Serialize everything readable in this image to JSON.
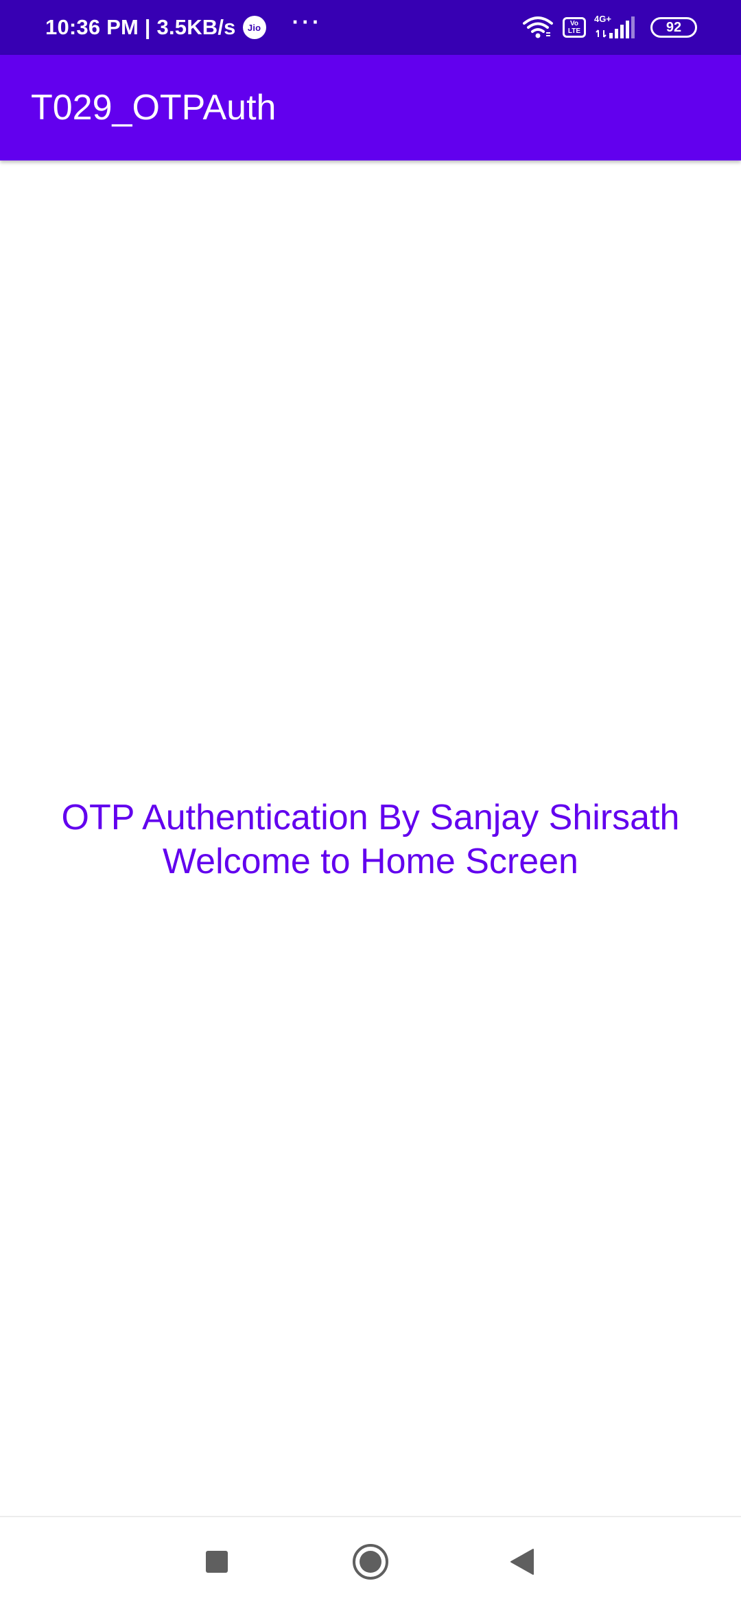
{
  "status_bar": {
    "time_speed": "10:36 PM | 3.5KB/s",
    "carrier_badge": "Jio",
    "more": "···",
    "volte": "Vo LTE",
    "network": "4G+",
    "battery": "92",
    "icons": [
      "wifi-icon",
      "volte-icon",
      "signal-icon",
      "battery-icon"
    ]
  },
  "app_bar": {
    "title": "T029_OTPAuth"
  },
  "content": {
    "line1": "OTP Authentication By Sanjay Shirsath",
    "line2": "Welcome to Home Screen"
  },
  "nav": {
    "icons": [
      "recents-icon",
      "home-icon",
      "back-icon"
    ]
  },
  "colors": {
    "status_bar": "#3700b3",
    "primary": "#6200ee",
    "background": "#ffffff"
  }
}
